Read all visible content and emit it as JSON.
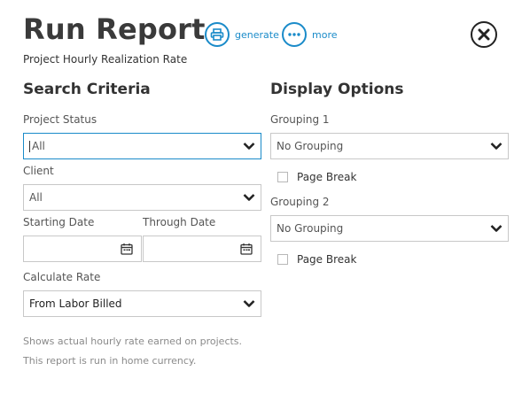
{
  "header": {
    "title": "Run Report",
    "subtitle": "Project Hourly Realization Rate",
    "actions": {
      "generate": "generate",
      "more": "more"
    }
  },
  "search_criteria": {
    "heading": "Search Criteria",
    "project_status": {
      "label": "Project Status",
      "value": "All"
    },
    "client": {
      "label": "Client",
      "value": "All"
    },
    "starting_date": {
      "label": "Starting Date",
      "value": ""
    },
    "through_date": {
      "label": "Through Date",
      "value": ""
    },
    "calculate_rate": {
      "label": "Calculate Rate",
      "value": "From Labor Billed"
    }
  },
  "display_options": {
    "heading": "Display Options",
    "grouping1": {
      "label": "Grouping 1",
      "value": "No Grouping",
      "page_break_label": "Page Break",
      "page_break_checked": false
    },
    "grouping2": {
      "label": "Grouping 2",
      "value": "No Grouping",
      "page_break_label": "Page Break",
      "page_break_checked": false
    }
  },
  "notes": {
    "line1": "Shows actual hourly rate earned on projects.",
    "line2": "This report is run in home currency."
  },
  "colors": {
    "accent": "#1a8bc9",
    "close": "#222222"
  }
}
